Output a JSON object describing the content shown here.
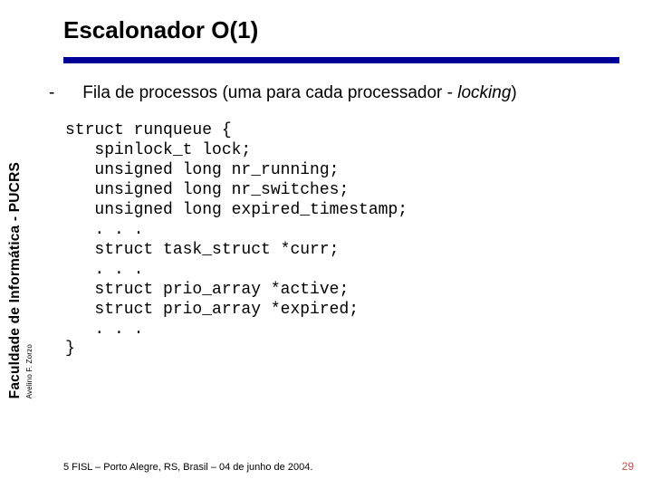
{
  "title": "Escalonador O(1)",
  "bullet": {
    "text_prefix": "Fila de processos (uma para cada processador - ",
    "text_em": "locking",
    "text_suffix": ")"
  },
  "code": "struct runqueue {\n   spinlock_t lock;\n   unsigned long nr_running;\n   unsigned long nr_switches;\n   unsigned long expired_timestamp;\n   . . .\n   struct task_struct *curr;\n   . . .\n   struct prio_array *active;\n   struct prio_array *expired;\n   . . .\n}",
  "side": {
    "institution": "Faculdade de Informática - PUCRS",
    "author": "Avelino F. Zorzo"
  },
  "footer": "5 FISL – Porto Alegre, RS, Brasil – 04 de junho de 2004.",
  "pagenum": "29"
}
